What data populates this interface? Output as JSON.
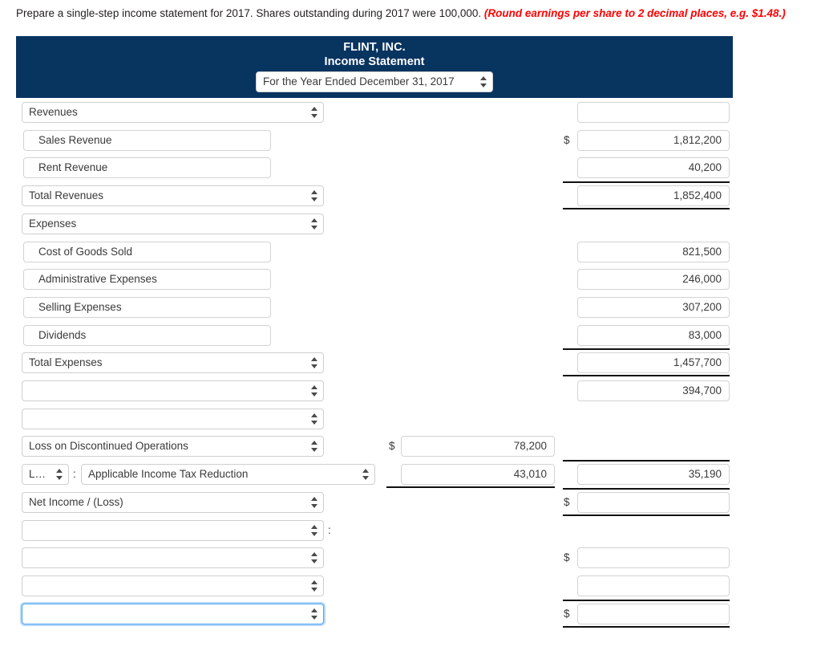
{
  "instruction": {
    "main": "Prepare a single-step income statement for 2017. Shares outstanding during 2017 were 100,000.",
    "hint": "(Round earnings per share to 2 decimal places, e.g. $1.48.)"
  },
  "statement_header": {
    "company_name": "FLINT, INC.",
    "statement_name": "Income Statement",
    "period_selected": "For the Year Ended December 31, 2017"
  },
  "symbols": {
    "dollar": "$",
    "colon": ":"
  },
  "rows": [
    {
      "label": "Revenues",
      "kind": "select",
      "amount": "",
      "amount_col": "right"
    },
    {
      "label": "Sales Revenue",
      "kind": "text",
      "amount": "1,812,200",
      "amount_col": "right",
      "dollar": true
    },
    {
      "label": "Rent Revenue",
      "kind": "text",
      "amount": "40,200",
      "amount_col": "right"
    },
    {
      "label": "Total Revenues",
      "kind": "select",
      "amount": "1,852,400",
      "amount_col": "right"
    },
    {
      "label": "Expenses",
      "kind": "select",
      "amount": "",
      "amount_col": "none"
    },
    {
      "label": "Cost of Goods Sold",
      "kind": "text",
      "amount": "821,500",
      "amount_col": "right"
    },
    {
      "label": "Administrative Expenses",
      "kind": "text",
      "amount": "246,000",
      "amount_col": "right"
    },
    {
      "label": "Selling Expenses",
      "kind": "text",
      "amount": "307,200",
      "amount_col": "right"
    },
    {
      "label": "Dividends",
      "kind": "text",
      "amount": "83,000",
      "amount_col": "right"
    },
    {
      "label": "Total Expenses",
      "kind": "select",
      "amount": "1,457,700",
      "amount_col": "right"
    },
    {
      "label": "",
      "kind": "select",
      "amount": "394,700",
      "amount_col": "right"
    },
    {
      "label": "",
      "kind": "select",
      "amount": "",
      "amount_col": "none"
    },
    {
      "label": "Loss on Discontinued Operations",
      "kind": "select",
      "amount": "78,200",
      "amount_col": "middle",
      "dollar": true
    },
    {
      "label": "Applicable Income Tax Reduction",
      "kind": "select-pair",
      "prefix": "Less",
      "amount": "43,010",
      "amount_col": "middle",
      "amount2": "35,190"
    },
    {
      "label": "Net Income / (Loss)",
      "kind": "select",
      "amount": "",
      "amount_col": "right",
      "dollar": true
    },
    {
      "label": "",
      "kind": "select",
      "amount": "",
      "amount_col": "none",
      "trailing_colon": true
    },
    {
      "label": "",
      "kind": "select",
      "amount": "",
      "amount_col": "right",
      "dollar": true
    },
    {
      "label": "",
      "kind": "select",
      "amount": "",
      "amount_col": "right"
    },
    {
      "label": "",
      "kind": "select",
      "amount": "",
      "amount_col": "right",
      "dollar": true,
      "focused": true
    }
  ]
}
